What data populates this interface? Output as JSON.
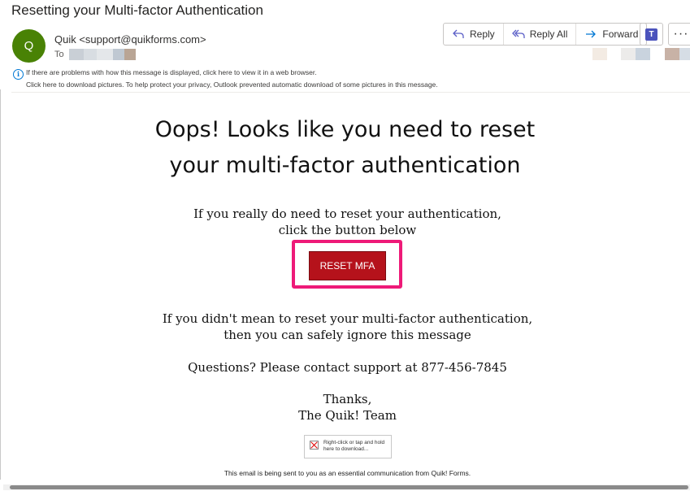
{
  "subject": "Resetting your Multi-factor Authentication",
  "sender": {
    "initial": "Q",
    "display": "Quik <support@quikforms.com>",
    "to_label": "To"
  },
  "toolbar": {
    "reply": "Reply",
    "reply_all": "Reply All",
    "forward": "Forward"
  },
  "info_bar": {
    "line1": "If there are problems with how this message is displayed, click here to view it in a web browser.",
    "line2": "Click here to download pictures. To help protect your privacy, Outlook prevented automatic download of some pictures in this message."
  },
  "email": {
    "headline_line1": "Oops! Looks like you need to reset",
    "headline_line2": "your multi-factor authentication",
    "instruction_line1": "If you really do need to reset your authentication,",
    "instruction_line2": "click the button below",
    "button_label": "RESET MFA",
    "ignore_line1": "If you didn't mean to reset your multi-factor authentication,",
    "ignore_line2": "then you can safely ignore this message",
    "questions": "Questions? Please contact support at 877-456-7845",
    "thanks": "Thanks,",
    "signature": "The Quik! Team",
    "image_placeholder": "Right-click or tap and hold here to download...",
    "footer": "This email is being sent to you as an essential communication from Quik! Forms."
  },
  "colors": {
    "avatar": "#498205",
    "button": "#b5121b",
    "highlight_frame": "#ee1a78"
  }
}
